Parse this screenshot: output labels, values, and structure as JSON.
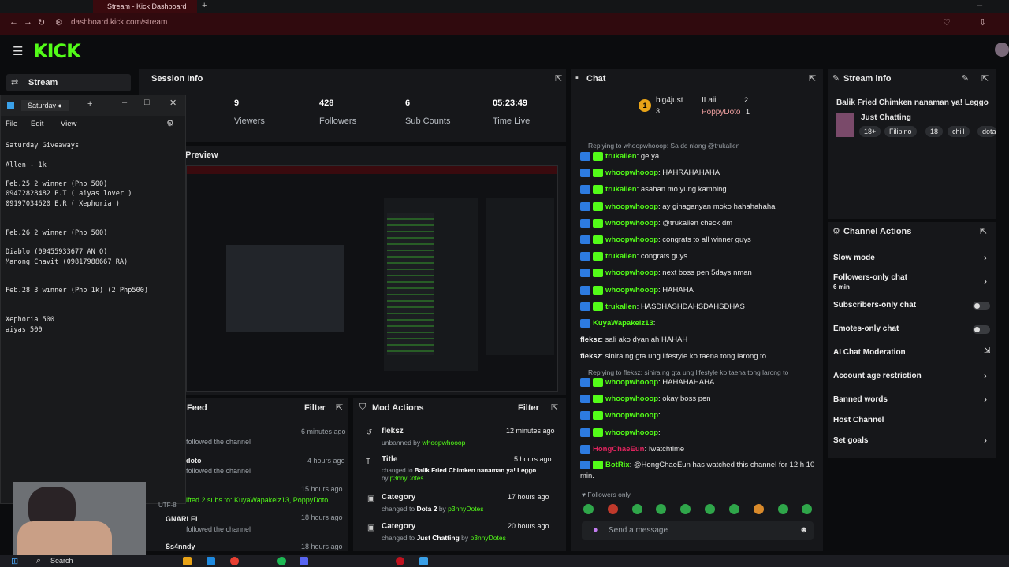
{
  "browser": {
    "tab_title": "Stream - Kick Dashboard",
    "url": "dashboard.kick.com/stream"
  },
  "kick": {
    "logo": "KICK",
    "nav_stream": "Stream"
  },
  "session": {
    "title": "Session Info",
    "stats": [
      {
        "value": "9",
        "label": "Viewers"
      },
      {
        "value": "428",
        "label": "Followers"
      },
      {
        "value": "6",
        "label": "Sub Counts"
      },
      {
        "value": "05:23:49",
        "label": "Time Live"
      }
    ]
  },
  "preview": {
    "title": "Preview"
  },
  "feed": {
    "title": "Feed",
    "filter": "Filter",
    "items": [
      {
        "line1": "followed the channel",
        "time": "6 minutes ago"
      },
      {
        "user": "doto",
        "line1": "followed the channel",
        "time": "4 hours ago"
      },
      {
        "line1": "ifted 2 subs to: KuyaWapakelz13, PoppyDoto",
        "time": "15 hours ago"
      },
      {
        "user": "GNARLEI",
        "line1": "followed the channel",
        "time": "18 hours ago"
      },
      {
        "user": "Ss4nndy",
        "time": "18 hours ago"
      }
    ]
  },
  "mod_actions": {
    "title": "Mod Actions",
    "filter": "Filter",
    "items": [
      {
        "head": "fleksz",
        "sub_pre": "unbanned by",
        "sub_user": "whoopwhooop",
        "time": "12 minutes ago"
      },
      {
        "head": "Title",
        "sub_pre": "changed to",
        "sub_val": "Balik Fried Chimken nanaman ya! Leggo",
        "sub_post": "by",
        "sub_user": "p3nnyDotes",
        "time": "5 hours ago"
      },
      {
        "head": "Category",
        "sub_pre": "changed to",
        "sub_val": "Dota 2",
        "sub_post": "by",
        "sub_user": "p3nnyDotes",
        "time": "17 hours ago"
      },
      {
        "head": "Category",
        "sub_pre": "changed to",
        "sub_val": "Just Chatting",
        "sub_post": "by",
        "sub_user": "p3nnyDotes",
        "time": "20 hours ago"
      }
    ]
  },
  "chat": {
    "title": "Chat",
    "top_gifters": [
      {
        "name": "big4just",
        "count": "3"
      },
      {
        "name": "ILaiii",
        "count": "2"
      },
      {
        "name": "PoppyDoto",
        "count": "1"
      }
    ],
    "reply1": "Replying to whoopwhooop: Sa dc nlang @trukallen",
    "messages": [
      {
        "user": "trukallen",
        "text": ": ge ya"
      },
      {
        "user": "whoopwhooop",
        "text": ": HAHRAHAHAHA"
      },
      {
        "user": "trukallen",
        "text": ": asahan mo yung kambing"
      },
      {
        "user": "whoopwhooop",
        "text": ": ay ginaganyan moko hahahahaha"
      },
      {
        "user": "whoopwhooop",
        "text": ": @trukallen check dm"
      },
      {
        "user": "whoopwhooop",
        "text": ": congrats to all winner guys"
      },
      {
        "user": "trukallen",
        "text": ": congrats guys"
      },
      {
        "user": "whoopwhooop",
        "text": ": next boss pen 5days nman"
      },
      {
        "user": "whoopwhooop",
        "text": ": HAHAHA"
      },
      {
        "user": "trukallen",
        "text": ": HASDHASHDAHSDAHSDHAS"
      },
      {
        "user": "KuyaWapakelz13",
        "text": ":"
      }
    ],
    "plain": [
      {
        "user": "fleksz",
        "text": ": sali ako dyan ah HAHAH"
      },
      {
        "user": "fleksz",
        "text": ": sinira ng gta ung lifestyle ko taena tong larong to"
      }
    ],
    "reply2": "Replying to fleksz: sinira ng gta ung lifestyle ko taena tong larong to",
    "messages2": [
      {
        "user": "whoopwhooop",
        "text": ": HAHAHAHAHA"
      },
      {
        "user": "whoopwhooop",
        "text": ": okay boss pen"
      },
      {
        "user": "whoopwhooop",
        "text": ":"
      },
      {
        "user": "whoopwhooop",
        "text": ":"
      },
      {
        "user": "HongChaeEun",
        "text": ": !watchtime"
      }
    ],
    "bot_user": "BotRix",
    "bot_text": ": @HongChaeEun has watched this channel for 12 h 10",
    "bot_text2": "min.",
    "followers_only": "Followers only",
    "send_placeholder": "Send a message"
  },
  "stream_info": {
    "title": "Stream info",
    "stream_title": "Balik Fried Chimken nanaman ya! Leggo",
    "category": "Just Chatting",
    "tags": [
      "18+",
      "Filipino",
      "18",
      "chill",
      "dota"
    ]
  },
  "channel_actions": {
    "title": "Channel Actions",
    "items": [
      {
        "label": "Slow mode"
      },
      {
        "label": "Followers-only chat",
        "sub": "6 min"
      },
      {
        "label": "Subscribers-only chat"
      },
      {
        "label": "Emotes-only chat"
      },
      {
        "label": "AI Chat Moderation"
      },
      {
        "label": "Account age restriction"
      },
      {
        "label": "Banned words"
      },
      {
        "label": "Host Channel"
      },
      {
        "label": "Set goals"
      }
    ]
  },
  "notepad": {
    "tab": "Saturday",
    "menu": [
      "File",
      "Edit",
      "View"
    ],
    "content": "Saturday Giveaways\n\nAllen - 1k\n\nFeb.25 2 winner (Php 500)\n09472828482 P.T ( aiyas lover )\n09197034620 E.R ( Xephoria )\n\n\nFeb.26 2 winner (Php 500)\n\nDiablo (09455933677 AN O)\nManong Chavit (09817988667 RA)\n\n\nFeb.28 3 winner (Php 1k) (2 Php500)\n\n\nXephoria 500\naiyas 500",
    "encoding": "UTF-8"
  },
  "taskbar": {
    "search": "Search"
  },
  "colors": {
    "accent": "#53fc18",
    "bg": "#0b0c0e",
    "panel": "#16171a",
    "browser": "#300a0e"
  }
}
